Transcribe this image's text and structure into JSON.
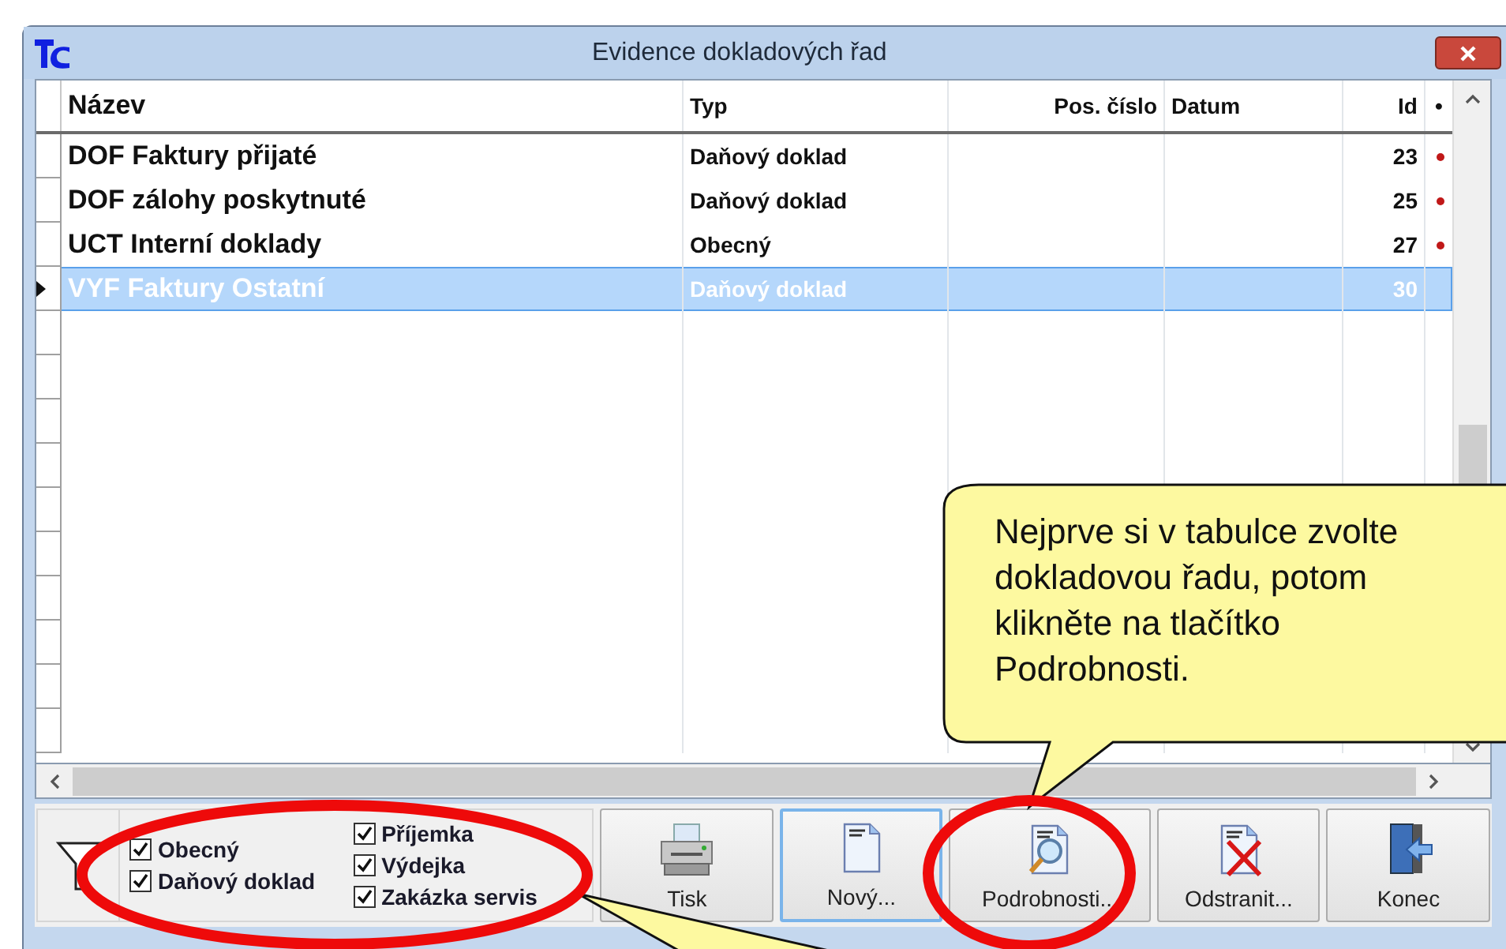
{
  "window": {
    "title": "Evidence dokladových řad"
  },
  "table": {
    "columns": [
      {
        "label": "Název"
      },
      {
        "label": "Typ"
      },
      {
        "label": "Pos. číslo"
      },
      {
        "label": "Datum"
      },
      {
        "label": "Id"
      },
      {
        "label": "•"
      }
    ],
    "rows": [
      {
        "name": "DOF Faktury přijaté",
        "type": "Daňový doklad",
        "number": "",
        "date": "",
        "id": "23",
        "flagged": true,
        "selected": false
      },
      {
        "name": "DOF zálohy poskytnuté",
        "type": "Daňový doklad",
        "number": "",
        "date": "",
        "id": "25",
        "flagged": true,
        "selected": false
      },
      {
        "name": "UCT Interní doklady",
        "type": "Obecný",
        "number": "",
        "date": "",
        "id": "27",
        "flagged": true,
        "selected": false
      },
      {
        "name": "VYF Faktury Ostatní",
        "type": "Daňový doklad",
        "number": "",
        "date": "",
        "id": "30",
        "flagged": false,
        "selected": true
      }
    ]
  },
  "filter": {
    "columns": [
      [
        {
          "label": "Obecný",
          "checked": true
        },
        {
          "label": "Daňový doklad",
          "checked": true
        }
      ],
      [
        {
          "label": "Příjemka",
          "checked": true
        },
        {
          "label": "Výdejka",
          "checked": true
        },
        {
          "label": "Zakázka servis",
          "checked": true
        }
      ]
    ]
  },
  "buttons": [
    {
      "kind": "print",
      "label": "Tisk",
      "default": false
    },
    {
      "kind": "new",
      "label": "Nový...",
      "default": true
    },
    {
      "kind": "details",
      "label": "Podrobnosti...",
      "default": false
    },
    {
      "kind": "delete",
      "label": "Odstranit...",
      "default": false
    },
    {
      "kind": "exit",
      "label": "Konec",
      "default": false
    }
  ],
  "callouts": [
    {
      "text": "Nejprve si v tabulce zvolte dokladovou řadu, potom klikněte na tlačítko Podrobnosti."
    }
  ]
}
